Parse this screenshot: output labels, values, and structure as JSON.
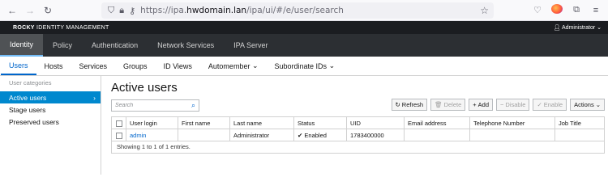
{
  "browser": {
    "url_prefix": "https://ipa.",
    "url_domain": "hwdomain.lan",
    "url_path": "/ipa/ui/#/e/user/search",
    "back_icon": "back-arrow-icon",
    "forward_icon": "forward-arrow-icon",
    "reload_icon": "reload-icon"
  },
  "masthead": {
    "brand_bold": "ROCKY",
    "brand_rest": " IDENTITY MANAGEMENT",
    "user_label": "Administrator"
  },
  "main_nav": [
    "Identity",
    "Policy",
    "Authentication",
    "Network Services",
    "IPA Server"
  ],
  "sub_nav": [
    "Users",
    "Hosts",
    "Services",
    "Groups",
    "ID Views",
    "Automember",
    "Subordinate IDs"
  ],
  "sidebar": {
    "heading": "User categories",
    "items": [
      "Active users",
      "Stage users",
      "Preserved users"
    ]
  },
  "page": {
    "title": "Active users",
    "search_placeholder": "Search",
    "buttons": {
      "refresh": "Refresh",
      "delete": "Delete",
      "add": "Add",
      "disable": "Disable",
      "enable": "Enable",
      "actions": "Actions"
    }
  },
  "table": {
    "headers": [
      "User login",
      "First name",
      "Last name",
      "Status",
      "UID",
      "Email address",
      "Telephone Number",
      "Job Title"
    ],
    "rows": [
      {
        "login": "admin",
        "first": "",
        "last": "Administrator",
        "status": "Enabled",
        "uid": "1783400000",
        "email": "",
        "phone": "",
        "job": ""
      }
    ],
    "footer": "Showing 1 to 1 of 1 entries."
  },
  "colors": {
    "accent": "#0088ce",
    "masthead": "#1b1d21",
    "nav": "#2c2f33",
    "link": "#0066cc"
  }
}
